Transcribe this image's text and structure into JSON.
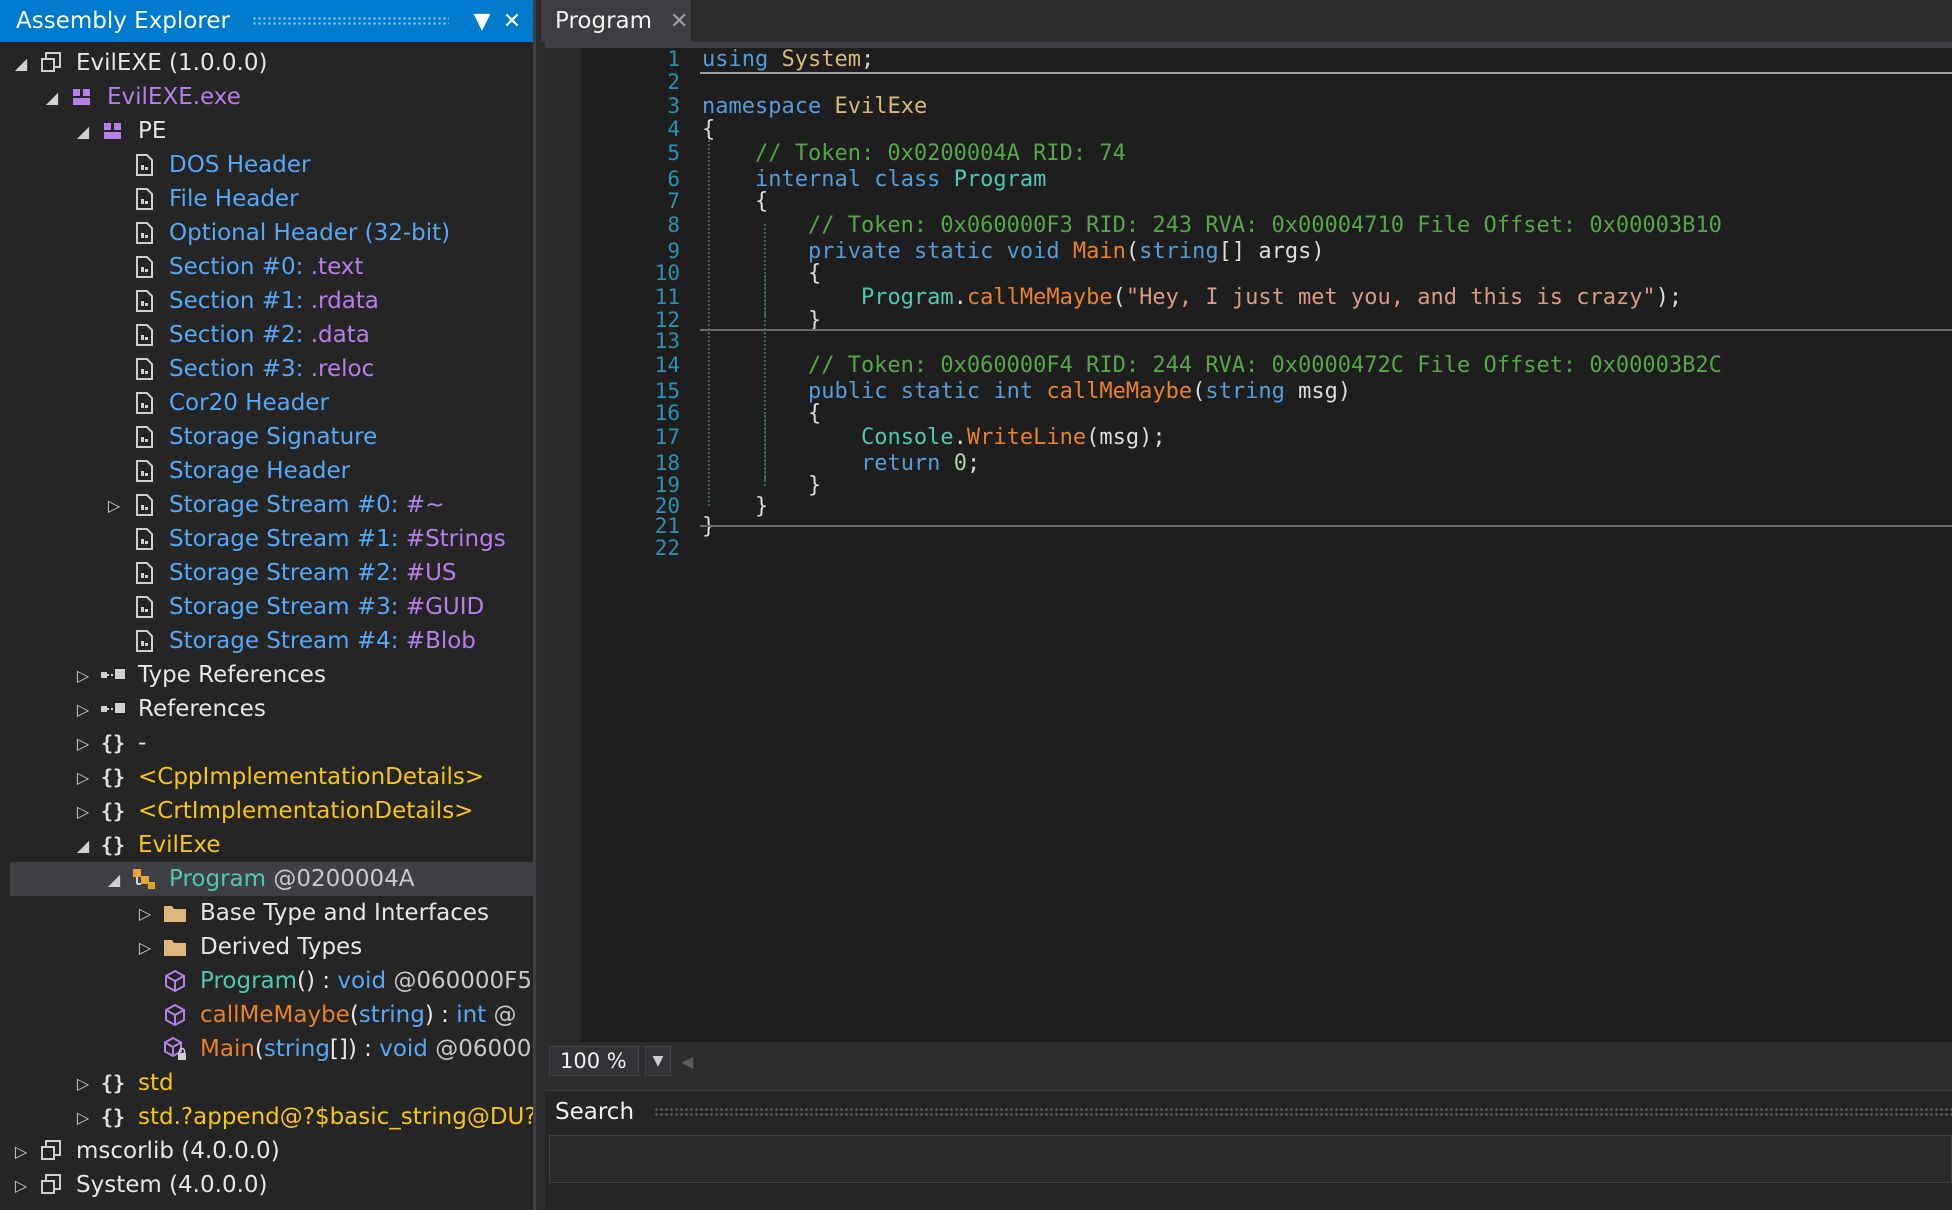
{
  "explorer": {
    "title": "Assembly Explorer",
    "tree": [
      {
        "indent": 0,
        "exp": "open",
        "icon": "assembly-icon",
        "parts": [
          [
            "EvilEXE (1.0.0.0)",
            "white"
          ]
        ]
      },
      {
        "indent": 1,
        "exp": "open",
        "icon": "module-icon",
        "parts": [
          [
            "EvilEXE.exe",
            "purple"
          ]
        ]
      },
      {
        "indent": 2,
        "exp": "open",
        "icon": "module-icon",
        "parts": [
          [
            "PE",
            "white"
          ]
        ]
      },
      {
        "indent": 3,
        "exp": "none",
        "icon": "document-icon",
        "parts": [
          [
            "DOS Header",
            "blue"
          ]
        ]
      },
      {
        "indent": 3,
        "exp": "none",
        "icon": "document-icon",
        "parts": [
          [
            "File Header",
            "blue"
          ]
        ]
      },
      {
        "indent": 3,
        "exp": "none",
        "icon": "document-icon",
        "parts": [
          [
            "Optional Header (32-bit)",
            "blue"
          ]
        ]
      },
      {
        "indent": 3,
        "exp": "none",
        "icon": "document-icon",
        "parts": [
          [
            "Section #0: ",
            "blue"
          ],
          [
            ".text",
            "purple"
          ]
        ]
      },
      {
        "indent": 3,
        "exp": "none",
        "icon": "document-icon",
        "parts": [
          [
            "Section #1: ",
            "blue"
          ],
          [
            ".rdata",
            "purple"
          ]
        ]
      },
      {
        "indent": 3,
        "exp": "none",
        "icon": "document-icon",
        "parts": [
          [
            "Section #2: ",
            "blue"
          ],
          [
            ".data",
            "purple"
          ]
        ]
      },
      {
        "indent": 3,
        "exp": "none",
        "icon": "document-icon",
        "parts": [
          [
            "Section #3: ",
            "blue"
          ],
          [
            ".reloc",
            "purple"
          ]
        ]
      },
      {
        "indent": 3,
        "exp": "none",
        "icon": "document-icon",
        "parts": [
          [
            "Cor20 Header",
            "blue"
          ]
        ]
      },
      {
        "indent": 3,
        "exp": "none",
        "icon": "document-icon",
        "parts": [
          [
            "Storage Signature",
            "blue"
          ]
        ]
      },
      {
        "indent": 3,
        "exp": "none",
        "icon": "document-icon",
        "parts": [
          [
            "Storage Header",
            "blue"
          ]
        ]
      },
      {
        "indent": 3,
        "exp": "closed",
        "icon": "document-icon",
        "parts": [
          [
            "Storage Stream #0: ",
            "blue"
          ],
          [
            "#~",
            "purple"
          ]
        ]
      },
      {
        "indent": 3,
        "exp": "none",
        "icon": "document-icon",
        "parts": [
          [
            "Storage Stream #1: ",
            "blue"
          ],
          [
            "#Strings",
            "purple"
          ]
        ]
      },
      {
        "indent": 3,
        "exp": "none",
        "icon": "document-icon",
        "parts": [
          [
            "Storage Stream #2: ",
            "blue"
          ],
          [
            "#US",
            "purple"
          ]
        ]
      },
      {
        "indent": 3,
        "exp": "none",
        "icon": "document-icon",
        "parts": [
          [
            "Storage Stream #3: ",
            "blue"
          ],
          [
            "#GUID",
            "purple"
          ]
        ]
      },
      {
        "indent": 3,
        "exp": "none",
        "icon": "document-icon",
        "parts": [
          [
            "Storage Stream #4: ",
            "blue"
          ],
          [
            "#Blob",
            "purple"
          ]
        ]
      },
      {
        "indent": 2,
        "exp": "closed",
        "icon": "references-icon",
        "parts": [
          [
            "Type References",
            "white"
          ]
        ]
      },
      {
        "indent": 2,
        "exp": "closed",
        "icon": "references-icon",
        "parts": [
          [
            "References",
            "white"
          ]
        ]
      },
      {
        "indent": 2,
        "exp": "closed",
        "icon": "namespace-icon",
        "parts": [
          [
            "-",
            "white"
          ]
        ]
      },
      {
        "indent": 2,
        "exp": "closed",
        "icon": "namespace-icon",
        "parts": [
          [
            "<CppImplementationDetails>",
            "yellow"
          ]
        ]
      },
      {
        "indent": 2,
        "exp": "closed",
        "icon": "namespace-icon",
        "parts": [
          [
            "<CrtImplementationDetails>",
            "yellow"
          ]
        ]
      },
      {
        "indent": 2,
        "exp": "open",
        "icon": "namespace-icon",
        "parts": [
          [
            "EvilExe",
            "yellow"
          ]
        ]
      },
      {
        "indent": 3,
        "exp": "open",
        "icon": "class-icon",
        "selected": true,
        "parts": [
          [
            "Program",
            "teal"
          ],
          [
            " @0200004A",
            "graytext"
          ]
        ]
      },
      {
        "indent": 4,
        "exp": "closed",
        "icon": "folder-icon",
        "parts": [
          [
            "Base Type and Interfaces",
            "white"
          ]
        ]
      },
      {
        "indent": 4,
        "exp": "closed",
        "icon": "folder-icon",
        "parts": [
          [
            "Derived Types",
            "white"
          ]
        ]
      },
      {
        "indent": 4,
        "exp": "none",
        "icon": "method-icon",
        "parts": [
          [
            "Program",
            "teal"
          ],
          [
            "() : ",
            "white"
          ],
          [
            "void",
            "blue"
          ],
          [
            " @060000F5",
            "graytext"
          ]
        ]
      },
      {
        "indent": 4,
        "exp": "none",
        "icon": "method-icon",
        "parts": [
          [
            "callMeMaybe",
            "orange"
          ],
          [
            "(",
            "white"
          ],
          [
            "string",
            "blue"
          ],
          [
            ") : ",
            "white"
          ],
          [
            "int",
            "blue"
          ],
          [
            " @",
            "graytext"
          ]
        ]
      },
      {
        "indent": 4,
        "exp": "none",
        "icon": "private-method-icon",
        "parts": [
          [
            "Main",
            "orange"
          ],
          [
            "(",
            "white"
          ],
          [
            "string",
            "blue"
          ],
          [
            "[]) : ",
            "white"
          ],
          [
            "void",
            "blue"
          ],
          [
            " @06000",
            "graytext"
          ]
        ]
      },
      {
        "indent": 2,
        "exp": "closed",
        "icon": "namespace-icon",
        "parts": [
          [
            "std",
            "yellow"
          ]
        ]
      },
      {
        "indent": 2,
        "exp": "closed",
        "icon": "namespace-icon",
        "parts": [
          [
            "std.?append@?$basic_string@DU?$",
            "yellow"
          ]
        ]
      },
      {
        "indent": 0,
        "exp": "closed",
        "icon": "assembly-icon",
        "parts": [
          [
            "mscorlib (4.0.0.0)",
            "white"
          ]
        ]
      },
      {
        "indent": 0,
        "exp": "closed",
        "icon": "assembly-icon",
        "parts": [
          [
            "System (4.0.0.0)",
            "white"
          ]
        ]
      }
    ]
  },
  "tab": {
    "label": "Program"
  },
  "code": {
    "lines": [
      {
        "n": "1",
        "t": [
          [
            "using",
            "kw"
          ],
          [
            " ",
            "pl"
          ],
          [
            "System",
            "ns"
          ],
          [
            ";",
            "pl"
          ]
        ]
      },
      {
        "n": "2",
        "t": []
      },
      {
        "n": "3",
        "t": [
          [
            "namespace",
            "kw"
          ],
          [
            " ",
            "pl"
          ],
          [
            "EvilExe",
            "ns"
          ]
        ]
      },
      {
        "n": "4",
        "t": [
          [
            "{",
            "pl"
          ]
        ]
      },
      {
        "n": "5",
        "t": [
          [
            "    // Token: 0x0200004A RID: 74",
            "cm"
          ]
        ]
      },
      {
        "n": "6",
        "t": [
          [
            "    ",
            "pl"
          ],
          [
            "internal",
            "kw"
          ],
          [
            " ",
            "pl"
          ],
          [
            "class",
            "kw"
          ],
          [
            " ",
            "pl"
          ],
          [
            "Program",
            "ty"
          ]
        ]
      },
      {
        "n": "7",
        "t": [
          [
            "    {",
            "pl"
          ]
        ]
      },
      {
        "n": "8",
        "t": [
          [
            "        // Token: 0x060000F3 RID: 243 RVA: 0x00004710 File Offset: 0x00003B10",
            "cm"
          ]
        ]
      },
      {
        "n": "9",
        "t": [
          [
            "        ",
            "pl"
          ],
          [
            "private",
            "kw"
          ],
          [
            " ",
            "pl"
          ],
          [
            "static",
            "kw"
          ],
          [
            " ",
            "pl"
          ],
          [
            "void",
            "kw"
          ],
          [
            " ",
            "pl"
          ],
          [
            "Main",
            "mt"
          ],
          [
            "(",
            "pl"
          ],
          [
            "string",
            "kw"
          ],
          [
            "[] args)",
            "pl"
          ]
        ]
      },
      {
        "n": "10",
        "t": [
          [
            "        {",
            "pl"
          ]
        ]
      },
      {
        "n": "11",
        "t": [
          [
            "            ",
            "pl"
          ],
          [
            "Program",
            "ty"
          ],
          [
            ".",
            "pl"
          ],
          [
            "callMeMaybe",
            "mt"
          ],
          [
            "(",
            "pl"
          ],
          [
            "\"Hey, I just met you, and this is crazy\"",
            "st"
          ],
          [
            ");",
            "pl"
          ]
        ]
      },
      {
        "n": "12",
        "t": [
          [
            "        }",
            "pl"
          ]
        ]
      },
      {
        "n": "13",
        "t": []
      },
      {
        "n": "14",
        "t": [
          [
            "        // Token: 0x060000F4 RID: 244 RVA: 0x0000472C File Offset: 0x00003B2C",
            "cm"
          ]
        ]
      },
      {
        "n": "15",
        "t": [
          [
            "        ",
            "pl"
          ],
          [
            "public",
            "kw"
          ],
          [
            " ",
            "pl"
          ],
          [
            "static",
            "kw"
          ],
          [
            " ",
            "pl"
          ],
          [
            "int",
            "kw"
          ],
          [
            " ",
            "pl"
          ],
          [
            "callMeMaybe",
            "mt"
          ],
          [
            "(",
            "pl"
          ],
          [
            "string",
            "kw"
          ],
          [
            " msg)",
            "pl"
          ]
        ]
      },
      {
        "n": "16",
        "t": [
          [
            "        {",
            "pl"
          ]
        ]
      },
      {
        "n": "17",
        "t": [
          [
            "            ",
            "pl"
          ],
          [
            "Console",
            "ty"
          ],
          [
            ".",
            "pl"
          ],
          [
            "WriteLine",
            "mt"
          ],
          [
            "(msg);",
            "pl"
          ]
        ]
      },
      {
        "n": "18",
        "t": [
          [
            "            ",
            "pl"
          ],
          [
            "return",
            "kw"
          ],
          [
            " ",
            "pl"
          ],
          [
            "0",
            "nm"
          ],
          [
            ";",
            "pl"
          ]
        ]
      },
      {
        "n": "19",
        "t": [
          [
            "        }",
            "pl"
          ]
        ]
      },
      {
        "n": "20",
        "t": [
          [
            "    }",
            "pl"
          ]
        ]
      },
      {
        "n": "21",
        "t": [
          [
            "}",
            "pl"
          ]
        ]
      },
      {
        "n": "22",
        "t": []
      }
    ]
  },
  "zoom": {
    "value": "100 %"
  },
  "search": {
    "title": "Search"
  }
}
